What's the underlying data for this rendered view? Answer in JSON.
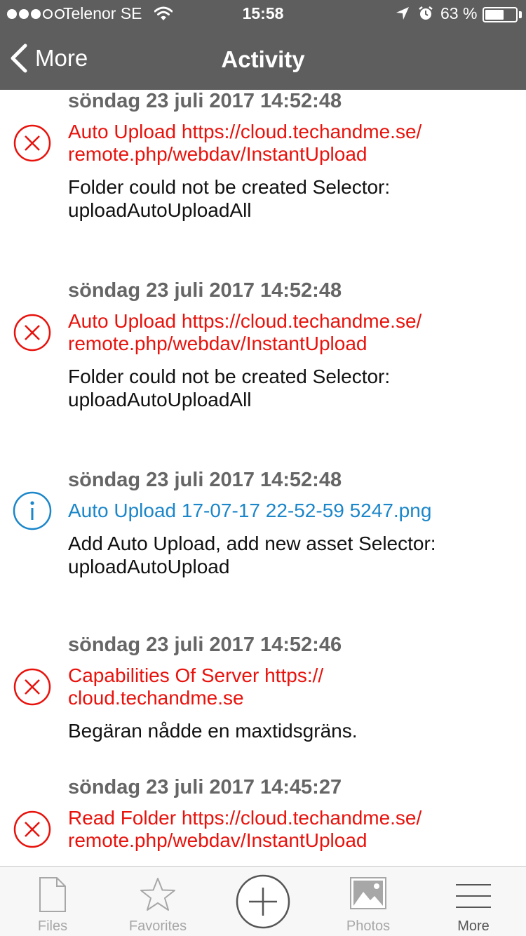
{
  "status_bar": {
    "carrier": "Telenor SE",
    "time": "15:58",
    "battery": "63 %",
    "battery_level": 0.63,
    "icons": [
      "signal-dots-icon",
      "wifi-icon",
      "location-arrow-icon",
      "alarm-clock-icon",
      "battery-icon"
    ]
  },
  "nav": {
    "back_label": "More",
    "title": "Activity"
  },
  "activities": [
    {
      "date": "söndag 23 juli 2017 14:52:48",
      "type": "error",
      "title_lines": [
        "Auto Upload https://cloud.techandme.se/",
        "remote.php/webdav/InstantUpload"
      ],
      "message_lines": [
        "Folder could not be created Selector:",
        "uploadAutoUploadAll"
      ]
    },
    {
      "date": "söndag 23 juli 2017 14:52:48",
      "type": "error",
      "title_lines": [
        "Auto Upload https://cloud.techandme.se/",
        "remote.php/webdav/InstantUpload"
      ],
      "message_lines": [
        "Folder could not be created Selector:",
        "uploadAutoUploadAll"
      ]
    },
    {
      "date": "söndag 23 juli 2017 14:52:48",
      "type": "info",
      "title_lines": [
        "Auto Upload 17-07-17 22-52-59 5247.png"
      ],
      "message_lines": [
        "Add Auto Upload, add new asset Selector:",
        "uploadAutoUpload"
      ]
    },
    {
      "date": "söndag 23 juli 2017 14:52:46",
      "type": "error",
      "title_lines": [
        "Capabilities Of Server https://",
        "cloud.techandme.se"
      ],
      "message_lines": [
        "Begäran nådde en maxtidsgräns."
      ]
    },
    {
      "date": "söndag 23 juli 2017 14:45:27",
      "type": "error",
      "title_lines": [
        "Read Folder https://cloud.techandme.se/",
        "remote.php/webdav/InstantUpload"
      ],
      "message_lines": []
    }
  ],
  "colors": {
    "header": "#5e5e5e",
    "error": "#e8120c",
    "info": "#1b86c9",
    "date": "#666666",
    "tab_inactive": "#a7a7a7",
    "tab_active": "#555555"
  },
  "tabs": [
    {
      "label": "Files",
      "icon": "file-icon",
      "selected": false
    },
    {
      "label": "Favorites",
      "icon": "star-icon",
      "selected": false
    },
    {
      "label": "",
      "icon": "add-circle-icon",
      "selected": false
    },
    {
      "label": "Photos",
      "icon": "photo-icon",
      "selected": false
    },
    {
      "label": "More",
      "icon": "menu-lines-icon",
      "selected": true
    }
  ]
}
